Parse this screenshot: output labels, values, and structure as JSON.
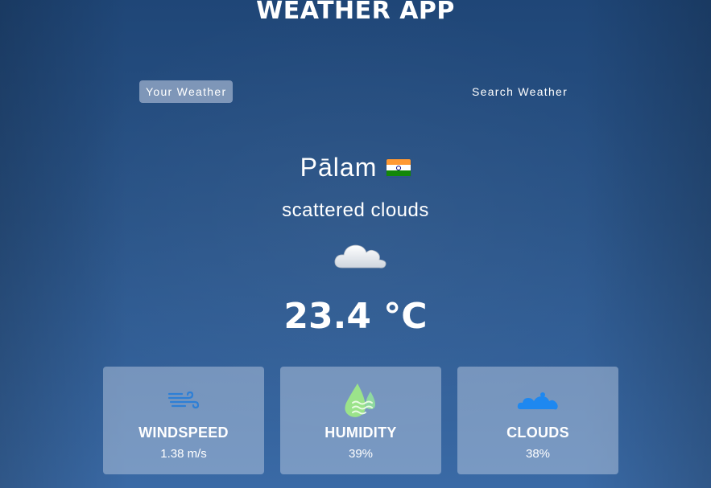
{
  "app": {
    "title": "WEATHER APP"
  },
  "tabs": [
    {
      "label": "Your Weather",
      "active": true
    },
    {
      "label": "Search Weather",
      "active": false
    }
  ],
  "location": {
    "city": "Pālam",
    "country_flag": "india-flag-icon"
  },
  "weather": {
    "description": "scattered clouds",
    "icon": "cloud-icon",
    "temperature": "23.4 °C"
  },
  "stats": [
    {
      "label": "WINDSPEED",
      "value": "1.38 m/s",
      "icon": "wind-icon"
    },
    {
      "label": "HUMIDITY",
      "value": "39%",
      "icon": "humidity-icon"
    },
    {
      "label": "CLOUDS",
      "value": "38%",
      "icon": "clouds-icon"
    }
  ],
  "colors": {
    "background_top": "#1f4677",
    "background_bottom": "#3a6aa6",
    "card_bg": "#c8d4e8",
    "wind_icon": "#2d7fd6",
    "humidity_icon": "#9be38a",
    "clouds_icon": "#1e88f0"
  }
}
